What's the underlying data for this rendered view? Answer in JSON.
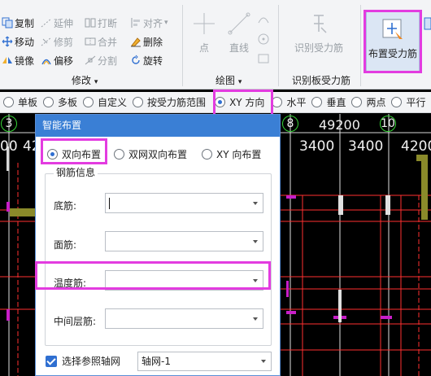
{
  "ribbon": {
    "modify_group": {
      "label": "修改",
      "items": [
        {
          "label": "复制",
          "icon": "copy-icon",
          "enabled": true
        },
        {
          "label": "延伸",
          "icon": "extend-icon",
          "enabled": false
        },
        {
          "label": "打断",
          "icon": "break-icon",
          "enabled": false
        },
        {
          "label": "对齐",
          "icon": "align-icon",
          "enabled": false
        },
        {
          "label": "移动",
          "icon": "move-icon",
          "enabled": true
        },
        {
          "label": "修剪",
          "icon": "trim-icon",
          "enabled": false
        },
        {
          "label": "合并",
          "icon": "merge-icon",
          "enabled": false
        },
        {
          "label": "删除",
          "icon": "delete-icon",
          "enabled": true
        },
        {
          "label": "镜像",
          "icon": "mirror-icon",
          "enabled": true
        },
        {
          "label": "偏移",
          "icon": "offset-icon",
          "enabled": true
        },
        {
          "label": "分割",
          "icon": "split-icon",
          "enabled": false
        },
        {
          "label": "旋转",
          "icon": "rotate-icon",
          "enabled": true
        }
      ]
    },
    "draw_group": {
      "label": "绘图",
      "point_label": "点",
      "line_label": "直线"
    },
    "identify_group": {
      "label": "识别板受力筋",
      "button_label": "识别受力筋"
    },
    "place_button_label": "布置受力筋",
    "accent_color": "#e33ce0"
  },
  "optbar": {
    "options": [
      {
        "label": "单板",
        "selected": false
      },
      {
        "label": "多板",
        "selected": false
      },
      {
        "label": "自定义",
        "selected": false
      },
      {
        "label": "按受力筋范围",
        "selected": false
      },
      {
        "label": "XY 方向",
        "selected": true
      },
      {
        "label": "水平",
        "selected": false
      },
      {
        "label": "垂直",
        "selected": false
      },
      {
        "label": "两点",
        "selected": false
      },
      {
        "label": "平行",
        "selected": false
      }
    ]
  },
  "canvas": {
    "axis_labels": [
      "3",
      "8",
      "10"
    ],
    "dimensions": [
      "00",
      "42",
      "49200",
      "3400",
      "3400",
      "4200"
    ]
  },
  "dialog": {
    "title": "智能布置",
    "layout_options": [
      {
        "label": "双向布置",
        "selected": true
      },
      {
        "label": "双网双向布置",
        "selected": false
      },
      {
        "label": "XY 向布置",
        "selected": false
      }
    ],
    "group_label": "钢筋信息",
    "fields": [
      {
        "label": "底筋:",
        "value": ""
      },
      {
        "label": "面筋:",
        "value": ""
      },
      {
        "label": "温度筋:",
        "value": ""
      },
      {
        "label": "中间层筋:",
        "value": ""
      }
    ],
    "checkbox_label": "选择参照轴网",
    "checkbox_checked": true,
    "grid_value": "轴网-1"
  }
}
